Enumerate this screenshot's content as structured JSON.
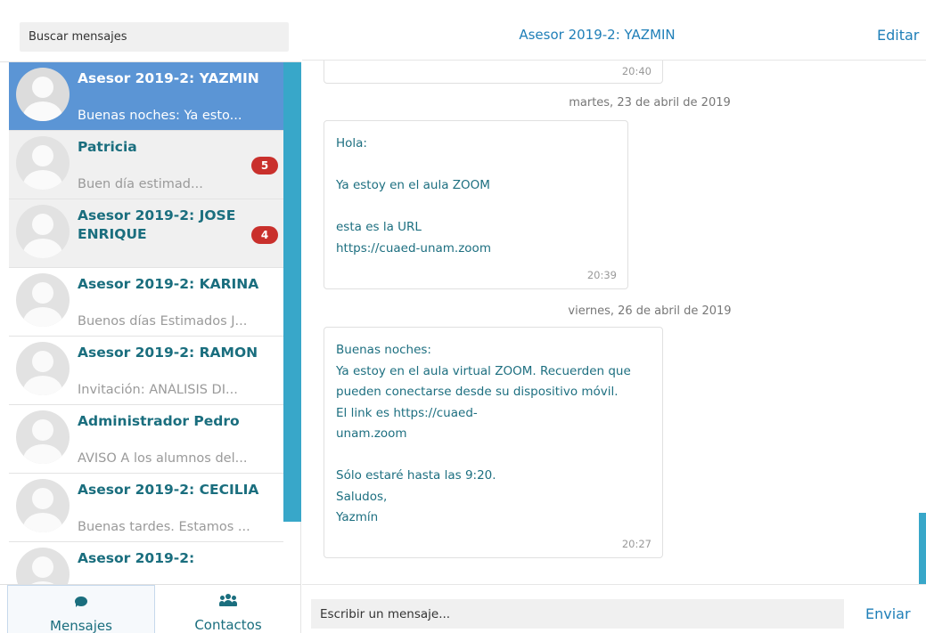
{
  "search": {
    "placeholder": "Buscar mensajes"
  },
  "conversations": [
    {
      "name": "Asesor 2019-2: YAZMIN",
      "preview": "Buenas noches: Ya esto...",
      "badge": ""
    },
    {
      "name": "Patricia",
      "preview": "Buen día estimad...",
      "badge": "5"
    },
    {
      "name": "Asesor 2019-2: JOSE ENRIQUE",
      "preview": "",
      "badge": "4"
    },
    {
      "name": "Asesor 2019-2: KARINA",
      "preview": "Buenos días Estimados J...",
      "badge": ""
    },
    {
      "name": "Asesor 2019-2: RAMON",
      "preview": "Invitación: ANÁLISIS DI...",
      "badge": ""
    },
    {
      "name": "Administrador Pedro",
      "preview": "AVISO A los alumnos del...",
      "badge": ""
    },
    {
      "name": "Asesor 2019-2: CECILIA",
      "preview": "Buenas tardes. Estamos ...",
      "badge": ""
    },
    {
      "name": "Asesor 2019-2:",
      "preview": "",
      "badge": ""
    }
  ],
  "nav": {
    "messages_label": "Mensajes",
    "contacts_label": "Contactos"
  },
  "header": {
    "title": "Asesor 2019-2: YAZMIN",
    "edit_label": "Editar"
  },
  "messages": [
    {
      "time": "20:40"
    },
    {
      "date": "martes, 23 de abril de 2019",
      "text": "Hola:\n\nYa estoy en el aula ZOOM\n\nesta es la URL\nhttps://cuaed-unam.zoom",
      "time": "20:39"
    },
    {
      "date": "viernes, 26 de abril de 2019",
      "text": "Buenas noches:\nYa estoy en el aula virtual ZOOM. Recuerden que\npueden conectarse desde su dispositivo móvil.\nEl link es https://cuaed-\nunam.zoom\n\nSólo estaré hasta las 9:20.\nSaludos,\nYazmín",
      "time": "20:27"
    }
  ],
  "composer": {
    "placeholder": "Escribir un mensaje...",
    "send_label": "Enviar"
  },
  "colors": {
    "accent": "#1f7fb8",
    "active_conversation": "#5b95d5",
    "name_text": "#1a6e7e",
    "badge": "#c9302c",
    "scrollbar": "#38a7c9"
  },
  "icons": {
    "messages": "comment-icon",
    "contacts": "users-icon"
  }
}
